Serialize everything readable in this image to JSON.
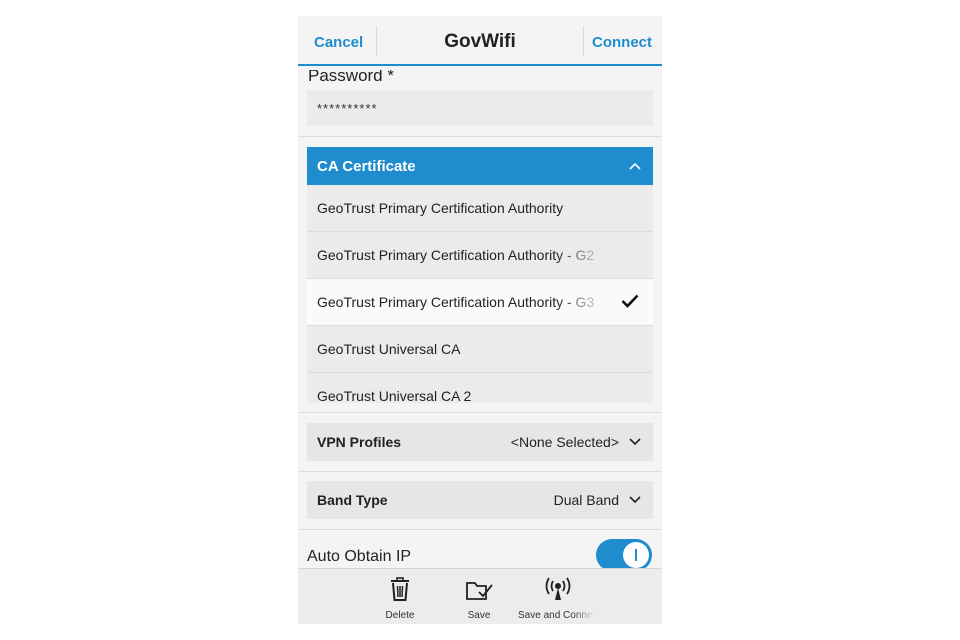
{
  "titlebar": {
    "cancel_label": "Cancel",
    "title": "GovWifi",
    "connect_label": "Connect"
  },
  "password": {
    "label": "Password *",
    "value": "**********"
  },
  "certificate": {
    "label": "CA Certificate",
    "items": [
      {
        "label": "GeoTrust Primary Certification Authority",
        "selected": false
      },
      {
        "label": "GeoTrust Primary Certification Authority - G2",
        "selected": false
      },
      {
        "label": "GeoTrust Primary Certification Authority - G3",
        "selected": true
      },
      {
        "label": "GeoTrust Universal CA",
        "selected": false
      },
      {
        "label": "GeoTrust Universal CA 2",
        "selected": false
      }
    ]
  },
  "vpn": {
    "label": "VPN Profiles",
    "value": "<None Selected>"
  },
  "band": {
    "label": "Band Type",
    "value": "Dual Band"
  },
  "auto_ip": {
    "label": "Auto Obtain IP",
    "enabled": true
  },
  "actions": [
    {
      "label": "Delete",
      "icon": "trash-icon"
    },
    {
      "label": "Save",
      "icon": "folder-check-icon"
    },
    {
      "label": "Save and Connect",
      "icon": "antenna-icon"
    }
  ],
  "colors": {
    "accent": "#1e8ccd",
    "background": "#f4f4f4",
    "field": "#ebebeb"
  }
}
